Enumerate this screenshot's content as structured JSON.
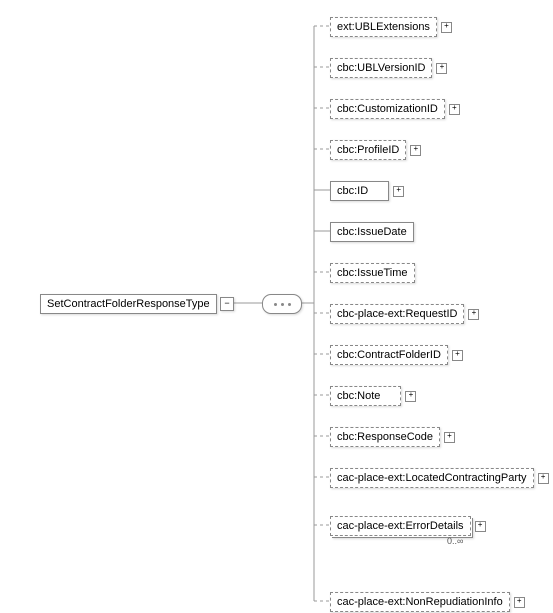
{
  "root": {
    "label": "SetContractFolderResponseType"
  },
  "children": [
    {
      "label": "ext:UBLExtensions",
      "optional": true,
      "expander": true
    },
    {
      "label": "cbc:UBLVersionID",
      "optional": true,
      "expander": true
    },
    {
      "label": "cbc:CustomizationID",
      "optional": true,
      "expander": true
    },
    {
      "label": "cbc:ProfileID",
      "optional": true,
      "expander": true
    },
    {
      "label": "cbc:ID",
      "optional": false,
      "expander": true
    },
    {
      "label": "cbc:IssueDate",
      "optional": false,
      "expander": false
    },
    {
      "label": "cbc:IssueTime",
      "optional": true,
      "expander": false
    },
    {
      "label": "cbc-place-ext:RequestID",
      "optional": true,
      "expander": true
    },
    {
      "label": "cbc:ContractFolderID",
      "optional": true,
      "expander": true
    },
    {
      "label": "cbc:Note",
      "optional": true,
      "expander": true
    },
    {
      "label": "cbc:ResponseCode",
      "optional": true,
      "expander": true
    },
    {
      "label": "cac-place-ext:LocatedContractingParty",
      "optional": true,
      "expander": true
    },
    {
      "label": "cac-place-ext:ErrorDetails",
      "optional": true,
      "expander": true,
      "cardinality": "0..∞"
    },
    {
      "label": "cac-place-ext:NonRepudiationInfo",
      "optional": true,
      "expander": true
    }
  ]
}
